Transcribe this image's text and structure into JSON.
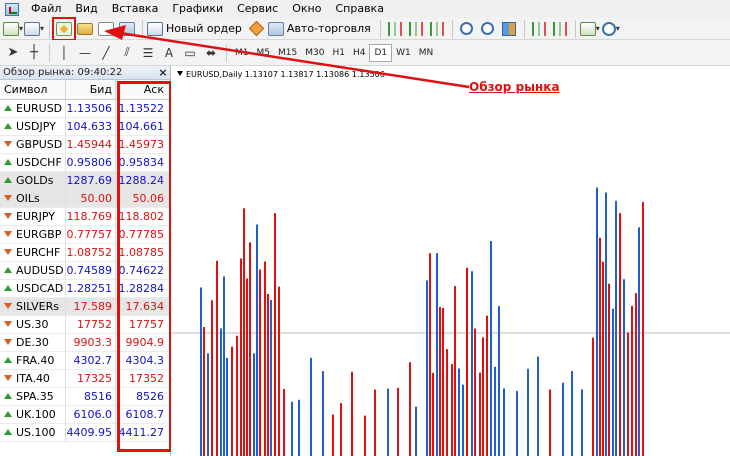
{
  "menu": {
    "items": [
      "Файл",
      "Вид",
      "Вставка",
      "Графики",
      "Сервис",
      "Окно",
      "Справка"
    ]
  },
  "toolbar": {
    "new_order_label": "Новый ордер",
    "autotrading_label": "Авто-торговля",
    "timeframes": [
      "M1",
      "M5",
      "M15",
      "M30",
      "H1",
      "H4",
      "D1",
      "W1",
      "MN"
    ],
    "active_timeframe": "D1"
  },
  "market_watch": {
    "title": "Обзор рынка: 09:40:22",
    "close_glyph": "×",
    "columns": {
      "symbol": "Символ",
      "bid": "Бид",
      "ask": "Аск"
    },
    "rows": [
      {
        "symbol": "EURUSD",
        "bid": "1.13506",
        "ask": "1.13522",
        "dir": "up",
        "color": "blue",
        "shade": false
      },
      {
        "symbol": "USDJPY",
        "bid": "104.633",
        "ask": "104.661",
        "dir": "up",
        "color": "blue",
        "shade": false
      },
      {
        "symbol": "GBPUSD",
        "bid": "1.45944",
        "ask": "1.45973",
        "dir": "down",
        "color": "red",
        "shade": false
      },
      {
        "symbol": "USDCHF",
        "bid": "0.95806",
        "ask": "0.95834",
        "dir": "up",
        "color": "blue",
        "shade": false
      },
      {
        "symbol": "GOLDs",
        "bid": "1287.69",
        "ask": "1288.24",
        "dir": "up",
        "color": "blue",
        "shade": true
      },
      {
        "symbol": "OILs",
        "bid": "50.00",
        "ask": "50.06",
        "dir": "down",
        "color": "red",
        "shade": true
      },
      {
        "symbol": "EURJPY",
        "bid": "118.769",
        "ask": "118.802",
        "dir": "down",
        "color": "red",
        "shade": false
      },
      {
        "symbol": "EURGBP",
        "bid": "0.77757",
        "ask": "0.77785",
        "dir": "down",
        "color": "red",
        "shade": false
      },
      {
        "symbol": "EURCHF",
        "bid": "1.08752",
        "ask": "1.08785",
        "dir": "down",
        "color": "red",
        "shade": false
      },
      {
        "symbol": "AUDUSD",
        "bid": "0.74589",
        "ask": "0.74622",
        "dir": "up",
        "color": "blue",
        "shade": false
      },
      {
        "symbol": "USDCAD",
        "bid": "1.28251",
        "ask": "1.28284",
        "dir": "up",
        "color": "blue",
        "shade": false
      },
      {
        "symbol": "SILVERs",
        "bid": "17.589",
        "ask": "17.634",
        "dir": "down",
        "color": "red",
        "shade": true
      },
      {
        "symbol": "US.30",
        "bid": "17752",
        "ask": "17757",
        "dir": "down",
        "color": "red",
        "shade": false
      },
      {
        "symbol": "DE.30",
        "bid": "9903.3",
        "ask": "9904.9",
        "dir": "down",
        "color": "red",
        "shade": false
      },
      {
        "symbol": "FRA.40",
        "bid": "4302.7",
        "ask": "4304.3",
        "dir": "up",
        "color": "blue",
        "shade": false
      },
      {
        "symbol": "ITA.40",
        "bid": "17325",
        "ask": "17352",
        "dir": "down",
        "color": "red",
        "shade": false
      },
      {
        "symbol": "SPA.35",
        "bid": "8516",
        "ask": "8526",
        "dir": "up",
        "color": "blue",
        "shade": false
      },
      {
        "symbol": "UK.100",
        "bid": "6106.0",
        "ask": "6108.7",
        "dir": "up",
        "color": "blue",
        "shade": false
      },
      {
        "symbol": "US.100",
        "bid": "4409.95",
        "ask": "4411.27",
        "dir": "up",
        "color": "blue",
        "shade": false
      }
    ]
  },
  "chart": {
    "info": "EURUSD,Daily  1.13107 1.13817 1.13086 1.13506"
  },
  "annotation": {
    "label": "Обзор рынка"
  },
  "colors": {
    "up": "#2f9a2f",
    "down": "#e05a1a",
    "price_red": "#e01010",
    "price_blue": "#1010d0",
    "highlight": "#e01010",
    "bull_bar": "#1f5fd0",
    "bear_bar": "#e01010",
    "grid_line": "#bbbbbb"
  }
}
